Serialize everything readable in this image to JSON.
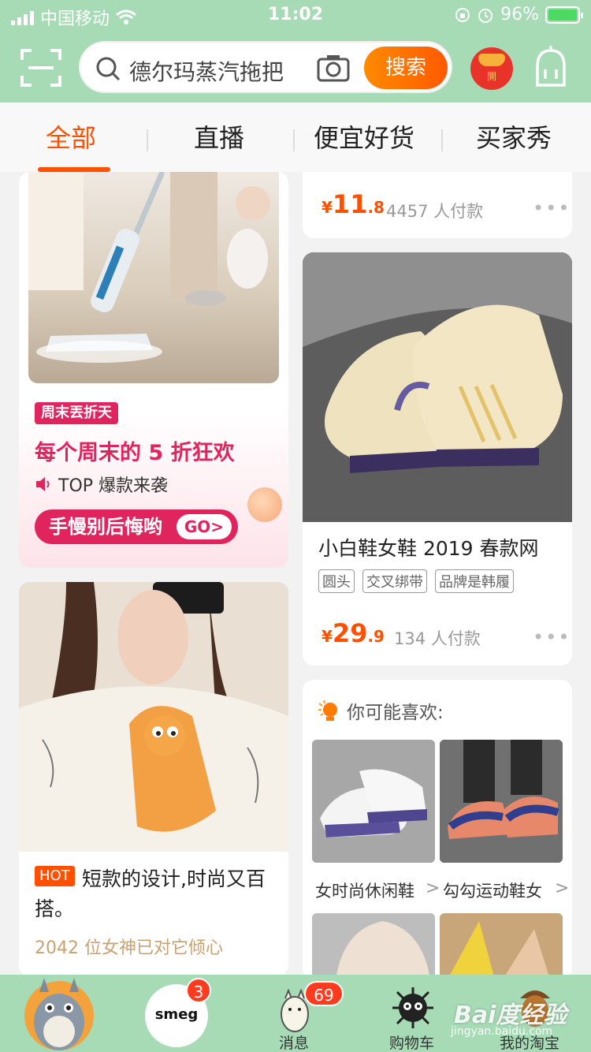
{
  "status_bar": {
    "carrier": "中国移动",
    "time": "11:02",
    "battery": "96%"
  },
  "header": {
    "search_text": "德尔玛蒸汽拖把",
    "search_button": "搜索",
    "redpack_label": "開"
  },
  "tabs": [
    {
      "label": "全部",
      "active": true
    },
    {
      "label": "直播",
      "active": false
    },
    {
      "label": "便宜好货",
      "active": false
    },
    {
      "label": "买家秀",
      "active": false
    }
  ],
  "promo_card": {
    "badge": "周末丟折天",
    "title": "每个周末的 5 折狂欢",
    "subtitle": "TOP 爆款来袭",
    "cta": "手慢别后悔哟",
    "cta_go": "GO>"
  },
  "sweater_card": {
    "hot_tag": "HOT",
    "title": "短款的设计,时尚又百搭。",
    "meta": "2042 位女神已对它倾心"
  },
  "fragment_card": {
    "price_symbol": "¥",
    "price_int": "11",
    "price_dec": ".8",
    "paid": "4457 人付款",
    "more": "•••"
  },
  "shoe_card": {
    "title": "小白鞋女鞋 2019 春款网",
    "tags": [
      "圆头",
      "交叉绑带",
      "品牌是韩履"
    ],
    "price_symbol": "¥",
    "price_int": "29",
    "price_dec": ".9",
    "paid": "134 人付款",
    "more": "•••"
  },
  "recommend": {
    "heading": "你可能喜欢:",
    "items": [
      {
        "label": "女时尚休闲鞋",
        "arrow": ">"
      },
      {
        "label": "勾勾运动鞋女",
        "arrow": ">"
      }
    ]
  },
  "bottom_nav": {
    "items": [
      {
        "label": "",
        "icon": "totoro-home-icon"
      },
      {
        "label": "",
        "icon": "smeg-logo",
        "badge": "3",
        "logo_text": "smeg"
      },
      {
        "label": "消息",
        "icon": "totoro-small-icon",
        "badge": "69"
      },
      {
        "label": "购物车",
        "icon": "soot-sprite-icon"
      },
      {
        "label": "我的淘宝",
        "icon": "acorn-icon"
      }
    ]
  },
  "watermark": {
    "text": "Bai度经验",
    "url": "jingyan.baidu.com"
  },
  "colors": {
    "header_green": "#a6dbb6",
    "accent_orange": "#ff5000",
    "promo_pink": "#e0245e"
  }
}
